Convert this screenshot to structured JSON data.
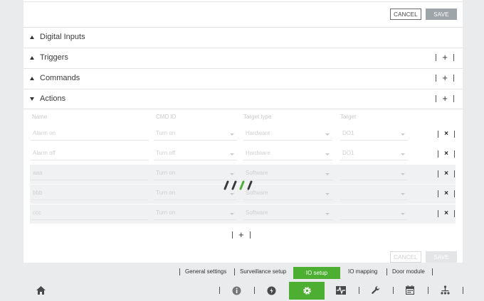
{
  "top_actions": {
    "cancel_label": "CANCEL",
    "save_label": "SAVE"
  },
  "sections": [
    {
      "title": "Digital Inputs",
      "expanded": false
    },
    {
      "title": "Triggers",
      "expanded": false
    },
    {
      "title": "Commands",
      "expanded": false
    },
    {
      "title": "Actions",
      "expanded": true
    }
  ],
  "section_controls": {
    "add_symbol": "+",
    "remove_symbol": "×"
  },
  "actions_table": {
    "columns": [
      "Name",
      "CMD ID",
      "Target type",
      "Target"
    ],
    "rows": [
      {
        "name": "Alarm on",
        "cmd": "Turn on",
        "target_type": "Hardware",
        "target": "DO1",
        "shaded": false
      },
      {
        "name": "Alarm off",
        "cmd": "Turn off",
        "target_type": "Hardware",
        "target": "DO1",
        "shaded": false
      },
      {
        "name": "aaa",
        "cmd": "Turn on",
        "target_type": "Software",
        "target": "",
        "shaded": true
      },
      {
        "name": "bbb",
        "cmd": "Turn on",
        "target_type": "Software",
        "target": "",
        "shaded": true
      },
      {
        "name": "ccc",
        "cmd": "Turn on",
        "target_type": "Software",
        "target": "",
        "shaded": true
      }
    ]
  },
  "bottom_actions": {
    "cancel_label": "CANCEL",
    "save_label": "SAVE"
  },
  "nav_tabs": {
    "general": "General settings",
    "surveillance": "Surveillance setup",
    "io_setup": "IO setup",
    "io_mapping": "IO mapping",
    "door_module": "Door module"
  },
  "toolbar_icons": [
    "home-icon",
    "info-icon",
    "power-icon",
    "gear-icon",
    "waveform-icon",
    "wrench-icon",
    "calendar-icon",
    "network-icon"
  ],
  "colors": {
    "accent": "#4caf32",
    "save_button": "#9ea5a9",
    "shaded_row": "#eff1f3",
    "background": "#e9ebec"
  }
}
